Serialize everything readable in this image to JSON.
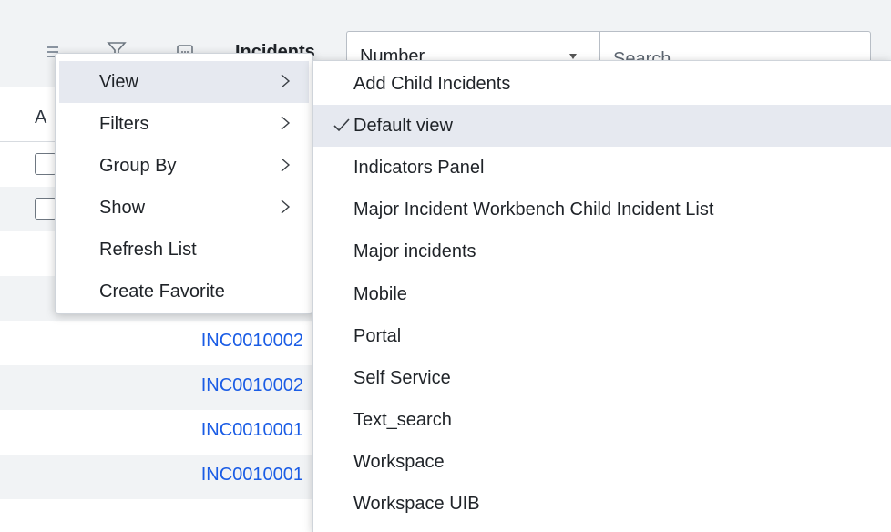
{
  "header": {
    "table_label": "Incidents",
    "field_select": {
      "value": "Number"
    },
    "search": {
      "placeholder": "Search"
    },
    "icons": [
      "hamburger-menu-icon",
      "filter-icon",
      "list-icon"
    ]
  },
  "table": {
    "header_first_col": "A",
    "rows": [
      {
        "number": ""
      },
      {
        "number": ""
      },
      {
        "number": ""
      },
      {
        "number": "INC0010002"
      },
      {
        "number": "INC0010002"
      },
      {
        "number": "INC0010001"
      },
      {
        "number": "INC0010001"
      }
    ]
  },
  "context_menu": {
    "items": [
      {
        "label": "View",
        "has_submenu": true
      },
      {
        "label": "Filters",
        "has_submenu": true
      },
      {
        "label": "Group By",
        "has_submenu": true
      },
      {
        "label": "Show",
        "has_submenu": true
      },
      {
        "label": "Refresh List",
        "has_submenu": false
      },
      {
        "label": "Create Favorite",
        "has_submenu": false
      }
    ]
  },
  "view_submenu": {
    "selected": "Default view",
    "items": [
      {
        "label": "Add Child Incidents"
      },
      {
        "label": "Default view",
        "checked": true
      },
      {
        "label": "Indicators Panel"
      },
      {
        "label": "Major Incident Workbench Child Incident List"
      },
      {
        "label": "Major incidents"
      },
      {
        "label": "Mobile"
      },
      {
        "label": "Portal"
      },
      {
        "label": "Self Service"
      },
      {
        "label": "Text_search"
      },
      {
        "label": "Workspace"
      },
      {
        "label": "Workspace UIB"
      }
    ]
  },
  "colors": {
    "link": "#1a5ce5",
    "header_bg": "#f1f3f5",
    "highlight": "#e6e9f0"
  }
}
